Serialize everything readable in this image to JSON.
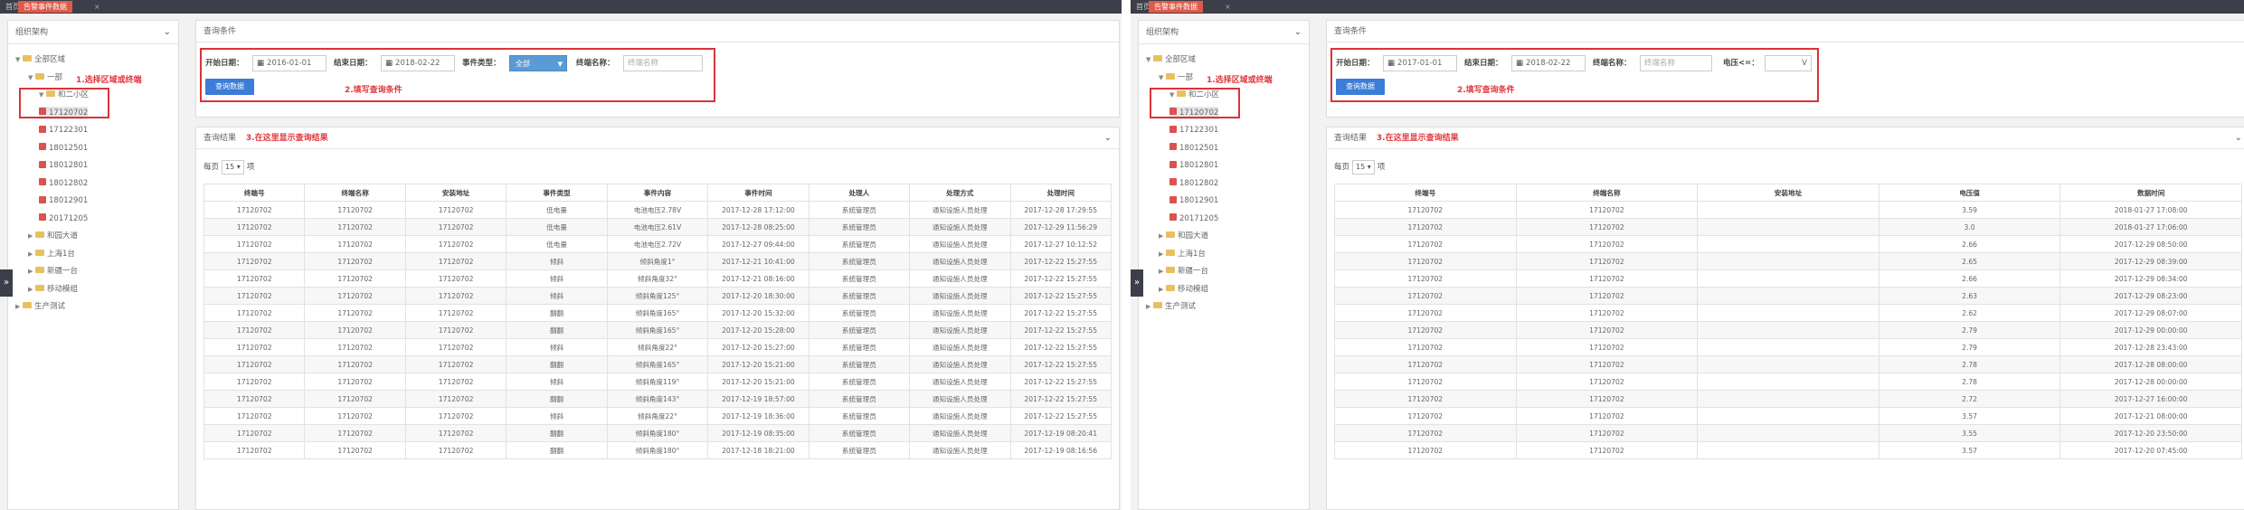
{
  "topbar": {
    "home": "首页",
    "active_tab": "告警事件数据",
    "close": "×"
  },
  "left": {
    "sidebar_title": "组织架构",
    "tree": [
      {
        "label": "全部区域",
        "caret": "▼",
        "type": "folder"
      },
      {
        "label": "一部",
        "caret": "▼",
        "type": "folder"
      },
      {
        "label": "和二小区",
        "caret": "▼",
        "type": "folder"
      },
      {
        "label": "17120702",
        "type": "node"
      },
      {
        "label": "17122301",
        "type": "node"
      },
      {
        "label": "18012501",
        "type": "node"
      },
      {
        "label": "18012801",
        "type": "node"
      },
      {
        "label": "18012802",
        "type": "node"
      },
      {
        "label": "18012901",
        "type": "node"
      },
      {
        "label": "20171205",
        "type": "node"
      },
      {
        "label": "和园大道",
        "caret": "▶",
        "type": "folder"
      },
      {
        "label": "上海1台",
        "caret": "▶",
        "type": "folder"
      },
      {
        "label": "新疆一台",
        "caret": "▶",
        "type": "folder"
      },
      {
        "label": "移动模组",
        "caret": "▶",
        "type": "folder"
      },
      {
        "label": "生产测试",
        "caret": "▶",
        "type": "folder"
      }
    ],
    "tree_annotation": "1.选择区域或终端",
    "query_title": "查询条件",
    "start_label": "开始日期：",
    "start_value": "2016-01-01",
    "end_label": "结束日期：",
    "end_value": "2018-02-22",
    "type_label": "事件类型：",
    "type_value": "全部",
    "term_label": "终端名称：",
    "term_placeholder": "终端名称",
    "query_button": "查询数据",
    "query_annotation": "2.填写查询条件",
    "result_title": "查询结果",
    "result_annotation": "3.在这里显示查询结果",
    "per_page_label": "每页",
    "per_page_value": "15",
    "per_page_unit": "项",
    "columns": [
      "终端号",
      "终端名称",
      "安装地址",
      "事件类型",
      "事件内容",
      "事件时间",
      "处理人",
      "处理方式",
      "处理时间"
    ],
    "rows": [
      [
        "17120702",
        "17120702",
        "17120702",
        "低电量",
        "电池电压2.78V",
        "2017-12-28 17:12:00",
        "系统管理员",
        "通知设施人员处理",
        "2017-12-28 17:29:55"
      ],
      [
        "17120702",
        "17120702",
        "17120702",
        "低电量",
        "电池电压2.61V",
        "2017-12-28 08:25:00",
        "系统管理员",
        "通知设施人员处理",
        "2017-12-29 11:56:29"
      ],
      [
        "17120702",
        "17120702",
        "17120702",
        "低电量",
        "电池电压2.72V",
        "2017-12-27 09:44:00",
        "系统管理员",
        "通知设施人员处理",
        "2017-12-27 10:12:52"
      ],
      [
        "17120702",
        "17120702",
        "17120702",
        "倾斜",
        "倾斜角度1°",
        "2017-12-21 10:41:00",
        "系统管理员",
        "通知设施人员处理",
        "2017-12-22 15:27:55"
      ],
      [
        "17120702",
        "17120702",
        "17120702",
        "倾斜",
        "倾斜角度32°",
        "2017-12-21 08:16:00",
        "系统管理员",
        "通知设施人员处理",
        "2017-12-22 15:27:55"
      ],
      [
        "17120702",
        "17120702",
        "17120702",
        "倾斜",
        "倾斜角度125°",
        "2017-12-20 18:30:00",
        "系统管理员",
        "通知设施人员处理",
        "2017-12-22 15:27:55"
      ],
      [
        "17120702",
        "17120702",
        "17120702",
        "翻翻",
        "倾斜角度165°",
        "2017-12-20 15:32:00",
        "系统管理员",
        "通知设施人员处理",
        "2017-12-22 15:27:55"
      ],
      [
        "17120702",
        "17120702",
        "17120702",
        "翻翻",
        "倾斜角度165°",
        "2017-12-20 15:28:00",
        "系统管理员",
        "通知设施人员处理",
        "2017-12-22 15:27:55"
      ],
      [
        "17120702",
        "17120702",
        "17120702",
        "倾斜",
        "倾斜角度22°",
        "2017-12-20 15:27:00",
        "系统管理员",
        "通知设施人员处理",
        "2017-12-22 15:27:55"
      ],
      [
        "17120702",
        "17120702",
        "17120702",
        "翻翻",
        "倾斜角度165°",
        "2017-12-20 15:21:00",
        "系统管理员",
        "通知设施人员处理",
        "2017-12-22 15:27:55"
      ],
      [
        "17120702",
        "17120702",
        "17120702",
        "倾斜",
        "倾斜角度119°",
        "2017-12-20 15:21:00",
        "系统管理员",
        "通知设施人员处理",
        "2017-12-22 15:27:55"
      ],
      [
        "17120702",
        "17120702",
        "17120702",
        "翻翻",
        "倾斜角度143°",
        "2017-12-19 18:57:00",
        "系统管理员",
        "通知设施人员处理",
        "2017-12-22 15:27:55"
      ],
      [
        "17120702",
        "17120702",
        "17120702",
        "倾斜",
        "倾斜角度22°",
        "2017-12-19 18:36:00",
        "系统管理员",
        "通知设施人员处理",
        "2017-12-22 15:27:55"
      ],
      [
        "17120702",
        "17120702",
        "17120702",
        "翻翻",
        "倾斜角度180°",
        "2017-12-19 08:35:00",
        "系统管理员",
        "通知设施人员处理",
        "2017-12-19 08:20:41"
      ],
      [
        "17120702",
        "17120702",
        "17120702",
        "翻翻",
        "倾斜角度180°",
        "2017-12-18 18:21:00",
        "系统管理员",
        "通知设施人员处理",
        "2017-12-19 08:16:56"
      ]
    ]
  },
  "right": {
    "sidebar_title": "组织架构",
    "tree": [
      {
        "label": "全部区域",
        "caret": "▼",
        "type": "folder"
      },
      {
        "label": "一部",
        "caret": "▼",
        "type": "folder"
      },
      {
        "label": "和二小区",
        "caret": "▼",
        "type": "folder"
      },
      {
        "label": "17120702",
        "type": "node"
      },
      {
        "label": "17122301",
        "type": "node"
      },
      {
        "label": "18012501",
        "type": "node"
      },
      {
        "label": "18012801",
        "type": "node"
      },
      {
        "label": "18012802",
        "type": "node"
      },
      {
        "label": "18012901",
        "type": "node"
      },
      {
        "label": "20171205",
        "type": "node"
      },
      {
        "label": "和园大道",
        "caret": "▶",
        "type": "folder"
      },
      {
        "label": "上海1台",
        "caret": "▶",
        "type": "folder"
      },
      {
        "label": "新疆一台",
        "caret": "▶",
        "type": "folder"
      },
      {
        "label": "移动模组",
        "caret": "▶",
        "type": "folder"
      },
      {
        "label": "生产测试",
        "caret": "▶",
        "type": "folder"
      }
    ],
    "tree_annotation": "1.选择区域或终端",
    "query_title": "查询条件",
    "start_label": "开始日期：",
    "start_value": "2017-01-01",
    "end_label": "结束日期：",
    "end_value": "2018-02-22",
    "term_label": "终端名称：",
    "term_placeholder": "终端名称",
    "volt_label": "电压<=：",
    "volt_unit": "V",
    "query_button": "查询数据",
    "query_annotation": "2.填写查询条件",
    "result_title": "查询结果",
    "result_annotation": "3.在这里显示查询结果",
    "per_page_label": "每页",
    "per_page_value": "15",
    "per_page_unit": "项",
    "columns": [
      "终端号",
      "终端名称",
      "安装地址",
      "电压值",
      "数据时间"
    ],
    "rows": [
      [
        "17120702",
        "17120702",
        "",
        "3.59",
        "2018-01-27 17:08:00"
      ],
      [
        "17120702",
        "17120702",
        "",
        "3.0",
        "2018-01-27 17:06:00"
      ],
      [
        "17120702",
        "17120702",
        "",
        "2.66",
        "2017-12-29 08:50:00"
      ],
      [
        "17120702",
        "17120702",
        "",
        "2.65",
        "2017-12-29 08:39:00"
      ],
      [
        "17120702",
        "17120702",
        "",
        "2.66",
        "2017-12-29 08:34:00"
      ],
      [
        "17120702",
        "17120702",
        "",
        "2.63",
        "2017-12-29 08:23:00"
      ],
      [
        "17120702",
        "17120702",
        "",
        "2.62",
        "2017-12-29 08:07:00"
      ],
      [
        "17120702",
        "17120702",
        "",
        "2.79",
        "2017-12-29 00:00:00"
      ],
      [
        "17120702",
        "17120702",
        "",
        "2.79",
        "2017-12-28 23:43:00"
      ],
      [
        "17120702",
        "17120702",
        "",
        "2.78",
        "2017-12-28 08:00:00"
      ],
      [
        "17120702",
        "17120702",
        "",
        "2.78",
        "2017-12-28 00:00:00"
      ],
      [
        "17120702",
        "17120702",
        "",
        "2.72",
        "2017-12-27 16:00:00"
      ],
      [
        "17120702",
        "17120702",
        "",
        "3.57",
        "2017-12-21 08:00:00"
      ],
      [
        "17120702",
        "17120702",
        "",
        "3.55",
        "2017-12-20 23:50:00"
      ],
      [
        "17120702",
        "17120702",
        "",
        "3.57",
        "2017-12-20 07:45:00"
      ]
    ]
  }
}
